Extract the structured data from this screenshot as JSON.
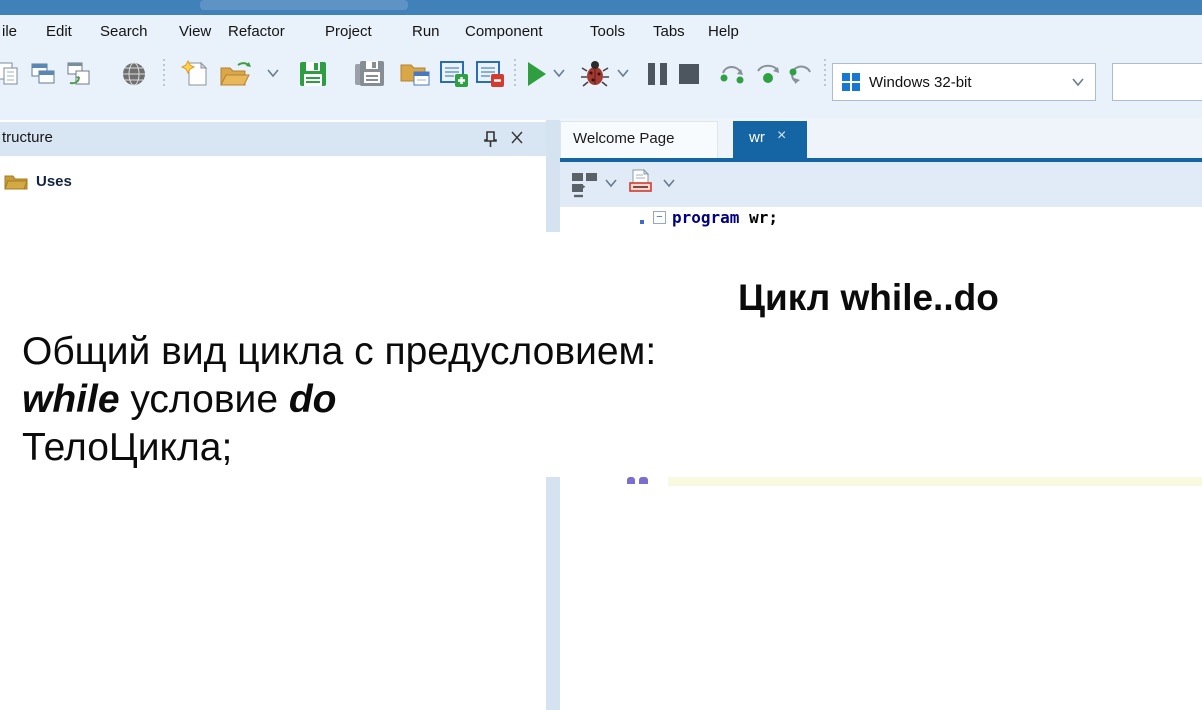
{
  "menu_bar": {
    "items": [
      "ile",
      "Edit",
      "Search",
      "View",
      "Refactor",
      "Project",
      "Run",
      "Component",
      "Tools",
      "Tabs",
      "Help"
    ]
  },
  "toolbar": {
    "icons": [
      "view-units-icon",
      "view-forms-icon",
      "toggle-form-unit-icon",
      "globe-icon",
      "new-unit-icon",
      "open-folder-icon",
      "save-icon",
      "save-all-icon",
      "save-as-icon",
      "unit-add-icon",
      "unit-remove-icon",
      "run-icon",
      "debug-icon",
      "pause-icon",
      "stop-icon",
      "step-over-icon",
      "step-into-icon",
      "step-out-icon"
    ],
    "target_combo": {
      "value": "Windows 32-bit",
      "icon": "windows-logo-icon"
    },
    "search_combo": {
      "value": ""
    }
  },
  "structure_panel": {
    "title": "tructure",
    "pin_icon": "pin-icon",
    "close_icon": "close-icon",
    "items": [
      {
        "icon": "folder-icon",
        "label": "Uses"
      }
    ]
  },
  "editor": {
    "tabs": [
      {
        "label": "Welcome Page",
        "active": false
      },
      {
        "label": "wr",
        "active": true,
        "close": "×"
      }
    ],
    "fold_marker": "−",
    "code": {
      "keyword": "program",
      "rest": " wr;"
    },
    "colors": {
      "keyword": "#000080",
      "active_tab": "#1565a5",
      "line_highlight": "#f8fadf",
      "title_bar": "#4181ba"
    }
  },
  "slide": {
    "title": "Цикл while..do",
    "line1": "Общий вид цикла с предусловием:",
    "line2_while": "while",
    "line2_mid": " условие ",
    "line2_do": "do",
    "line3": "ТелоЦикла;"
  }
}
